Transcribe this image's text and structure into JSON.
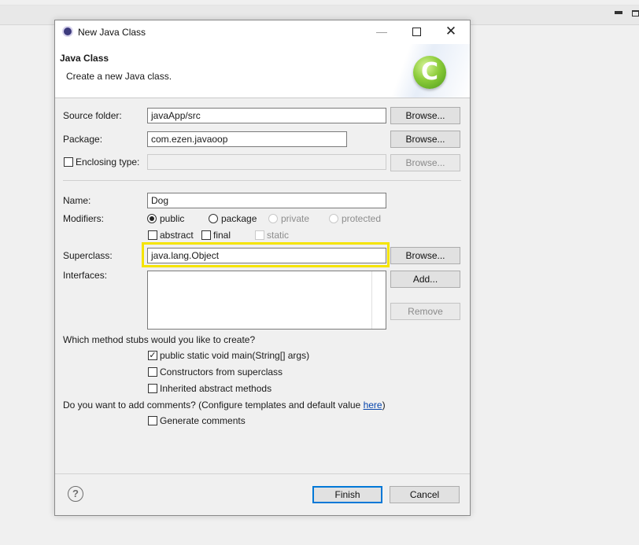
{
  "dialog": {
    "title": "New Java Class",
    "banner_title": "Java Class",
    "banner_subtitle": "Create a new Java class.",
    "icons": {
      "window": "eclipse-icon",
      "class": "java-class-c-icon",
      "help": "question-mark-icon"
    }
  },
  "form": {
    "source_folder": {
      "label": "Source folder:",
      "value": "javaApp/src",
      "button": "Browse..."
    },
    "package": {
      "label": "Package:",
      "value": "com.ezen.javaoop",
      "button": "Browse..."
    },
    "enclosing_type": {
      "label": "Enclosing type:",
      "value": "",
      "checked": false,
      "button": "Browse..."
    },
    "name": {
      "label": "Name:",
      "value": "Dog"
    },
    "modifiers": {
      "label": "Modifiers:",
      "access": [
        {
          "label": "public",
          "checked": true,
          "enabled": true
        },
        {
          "label": "package",
          "checked": false,
          "enabled": true
        },
        {
          "label": "private",
          "checked": false,
          "enabled": false
        },
        {
          "label": "protected",
          "checked": false,
          "enabled": false
        }
      ],
      "flags": [
        {
          "label": "abstract",
          "checked": false,
          "enabled": true
        },
        {
          "label": "final",
          "checked": false,
          "enabled": true
        },
        {
          "label": "static",
          "checked": false,
          "enabled": false
        }
      ]
    },
    "superclass": {
      "label": "Superclass:",
      "value": "java.lang.Object",
      "button": "Browse..."
    },
    "interfaces": {
      "label": "Interfaces:",
      "add_button": "Add...",
      "remove_button": "Remove"
    },
    "stubs": {
      "question": "Which method stubs would you like to create?",
      "options": [
        {
          "label": "public static void main(String[] args)",
          "checked": true
        },
        {
          "label": "Constructors from superclass",
          "checked": false
        },
        {
          "label": "Inherited abstract methods",
          "checked": false
        }
      ]
    },
    "comments": {
      "question": "Do you want to add comments? (Configure templates and default value ",
      "link": "here",
      "question_end": ")",
      "option": {
        "label": "Generate comments",
        "checked": false
      }
    }
  },
  "footer": {
    "finish": "Finish",
    "cancel": "Cancel"
  },
  "colors": {
    "highlight": "#f5e400",
    "default_button": "#0078d7",
    "link": "#0645ad"
  }
}
